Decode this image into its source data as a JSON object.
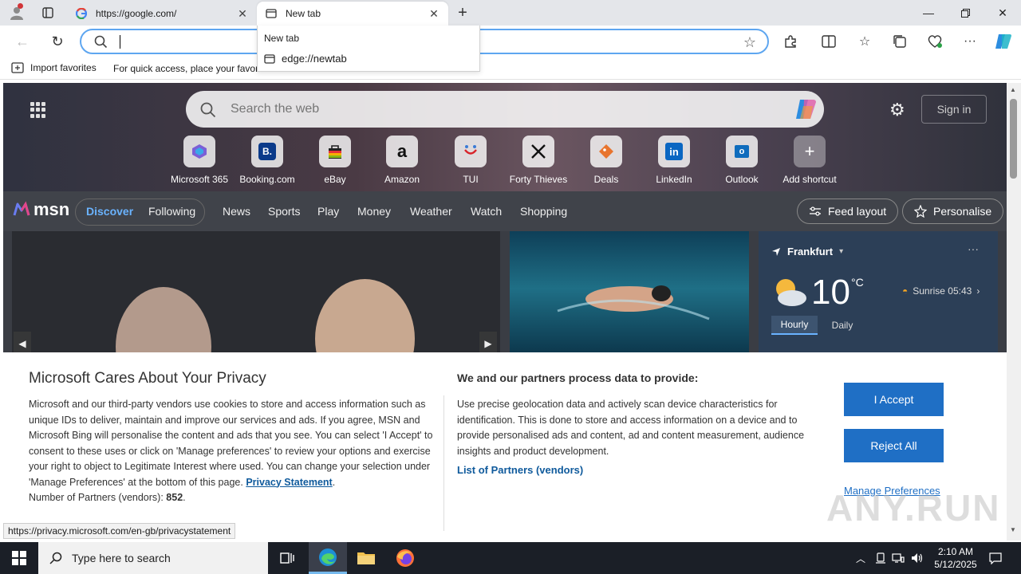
{
  "tabs": [
    {
      "title": "https://google.com/",
      "active": false
    },
    {
      "title": "New tab",
      "active": true
    }
  ],
  "toolbar": {
    "address_value": "",
    "address_placeholder": ""
  },
  "dropdown": {
    "title": "New tab",
    "url": "edge://newtab"
  },
  "favorites_bar": {
    "import_label": "Import favorites",
    "hint": "For quick access, place your favori"
  },
  "newtab": {
    "search_placeholder": "Search the web",
    "signin_label": "Sign in",
    "shortcuts": [
      {
        "label": "Microsoft 365",
        "icon": "microsoft-365-icon"
      },
      {
        "label": "Booking.com",
        "icon": "booking-icon"
      },
      {
        "label": "eBay",
        "icon": "ebay-icon"
      },
      {
        "label": "Amazon",
        "icon": "amazon-icon"
      },
      {
        "label": "TUI",
        "icon": "tui-icon"
      },
      {
        "label": "Forty Thieves",
        "icon": "forty-thieves-icon"
      },
      {
        "label": "Deals",
        "icon": "deals-icon"
      },
      {
        "label": "LinkedIn",
        "icon": "linkedin-icon"
      },
      {
        "label": "Outlook",
        "icon": "outlook-icon"
      },
      {
        "label": "Add shortcut",
        "icon": "plus-icon"
      }
    ]
  },
  "msn": {
    "logo": "msn",
    "pill": {
      "discover": "Discover",
      "following": "Following"
    },
    "nav": [
      "News",
      "Sports",
      "Play",
      "Money",
      "Weather",
      "Watch",
      "Shopping"
    ],
    "feed_layout": "Feed layout",
    "personalise": "Personalise"
  },
  "weather": {
    "city": "Frankfurt",
    "temp": "10",
    "unit": "°C",
    "sunrise": "Sunrise 05:43",
    "tabs": [
      "Hourly",
      "Daily"
    ]
  },
  "privacy": {
    "title": "Microsoft Cares About Your Privacy",
    "body": "Microsoft and our third-party vendors use cookies to store and access information such as unique IDs to deliver, maintain and improve our services and ads. If you agree, MSN and Microsoft Bing will personalise the content and ads that you see. You can select 'I Accept' to consent to these uses or click on 'Manage preferences' to review your options and exercise your right to object to Legitimate Interest where used.  You can change your selection under 'Manage Preferences' at the bottom of this page.",
    "privacy_link": "Privacy Statement",
    "partners_label": "Number of Partners (vendors):",
    "partners_count": "852",
    "right_title": "We and our partners process data to provide:",
    "right_body": "Use precise geolocation data and actively scan device characteristics for identification. This is done to store and access information on a device and to provide personalised ads and content, ad and content measurement, audience insights and product development.",
    "partners_link": "List of Partners (vendors)",
    "accept": "I Accept",
    "reject": "Reject All",
    "manage": "Manage Preferences"
  },
  "status_url": "https://privacy.microsoft.com/en-gb/privacystatement",
  "watermark": "ANY.RUN",
  "taskbar": {
    "search_placeholder": "Type here to search",
    "time": "2:10 AM",
    "date": "5/12/2025"
  },
  "colors": {
    "accent": "#1f6fc5",
    "link": "#0f5a9c",
    "msn_selected": "#6ab3ff"
  }
}
